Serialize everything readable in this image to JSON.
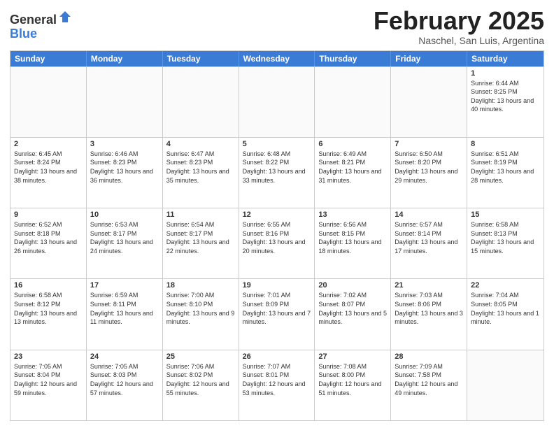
{
  "header": {
    "logo_general": "General",
    "logo_blue": "Blue",
    "month_title": "February 2025",
    "subtitle": "Naschel, San Luis, Argentina"
  },
  "days_of_week": [
    "Sunday",
    "Monday",
    "Tuesday",
    "Wednesday",
    "Thursday",
    "Friday",
    "Saturday"
  ],
  "weeks": [
    [
      {
        "day": "",
        "info": ""
      },
      {
        "day": "",
        "info": ""
      },
      {
        "day": "",
        "info": ""
      },
      {
        "day": "",
        "info": ""
      },
      {
        "day": "",
        "info": ""
      },
      {
        "day": "",
        "info": ""
      },
      {
        "day": "1",
        "info": "Sunrise: 6:44 AM\nSunset: 8:25 PM\nDaylight: 13 hours and 40 minutes."
      }
    ],
    [
      {
        "day": "2",
        "info": "Sunrise: 6:45 AM\nSunset: 8:24 PM\nDaylight: 13 hours and 38 minutes."
      },
      {
        "day": "3",
        "info": "Sunrise: 6:46 AM\nSunset: 8:23 PM\nDaylight: 13 hours and 36 minutes."
      },
      {
        "day": "4",
        "info": "Sunrise: 6:47 AM\nSunset: 8:23 PM\nDaylight: 13 hours and 35 minutes."
      },
      {
        "day": "5",
        "info": "Sunrise: 6:48 AM\nSunset: 8:22 PM\nDaylight: 13 hours and 33 minutes."
      },
      {
        "day": "6",
        "info": "Sunrise: 6:49 AM\nSunset: 8:21 PM\nDaylight: 13 hours and 31 minutes."
      },
      {
        "day": "7",
        "info": "Sunrise: 6:50 AM\nSunset: 8:20 PM\nDaylight: 13 hours and 29 minutes."
      },
      {
        "day": "8",
        "info": "Sunrise: 6:51 AM\nSunset: 8:19 PM\nDaylight: 13 hours and 28 minutes."
      }
    ],
    [
      {
        "day": "9",
        "info": "Sunrise: 6:52 AM\nSunset: 8:18 PM\nDaylight: 13 hours and 26 minutes."
      },
      {
        "day": "10",
        "info": "Sunrise: 6:53 AM\nSunset: 8:17 PM\nDaylight: 13 hours and 24 minutes."
      },
      {
        "day": "11",
        "info": "Sunrise: 6:54 AM\nSunset: 8:17 PM\nDaylight: 13 hours and 22 minutes."
      },
      {
        "day": "12",
        "info": "Sunrise: 6:55 AM\nSunset: 8:16 PM\nDaylight: 13 hours and 20 minutes."
      },
      {
        "day": "13",
        "info": "Sunrise: 6:56 AM\nSunset: 8:15 PM\nDaylight: 13 hours and 18 minutes."
      },
      {
        "day": "14",
        "info": "Sunrise: 6:57 AM\nSunset: 8:14 PM\nDaylight: 13 hours and 17 minutes."
      },
      {
        "day": "15",
        "info": "Sunrise: 6:58 AM\nSunset: 8:13 PM\nDaylight: 13 hours and 15 minutes."
      }
    ],
    [
      {
        "day": "16",
        "info": "Sunrise: 6:58 AM\nSunset: 8:12 PM\nDaylight: 13 hours and 13 minutes."
      },
      {
        "day": "17",
        "info": "Sunrise: 6:59 AM\nSunset: 8:11 PM\nDaylight: 13 hours and 11 minutes."
      },
      {
        "day": "18",
        "info": "Sunrise: 7:00 AM\nSunset: 8:10 PM\nDaylight: 13 hours and 9 minutes."
      },
      {
        "day": "19",
        "info": "Sunrise: 7:01 AM\nSunset: 8:09 PM\nDaylight: 13 hours and 7 minutes."
      },
      {
        "day": "20",
        "info": "Sunrise: 7:02 AM\nSunset: 8:07 PM\nDaylight: 13 hours and 5 minutes."
      },
      {
        "day": "21",
        "info": "Sunrise: 7:03 AM\nSunset: 8:06 PM\nDaylight: 13 hours and 3 minutes."
      },
      {
        "day": "22",
        "info": "Sunrise: 7:04 AM\nSunset: 8:05 PM\nDaylight: 13 hours and 1 minute."
      }
    ],
    [
      {
        "day": "23",
        "info": "Sunrise: 7:05 AM\nSunset: 8:04 PM\nDaylight: 12 hours and 59 minutes."
      },
      {
        "day": "24",
        "info": "Sunrise: 7:05 AM\nSunset: 8:03 PM\nDaylight: 12 hours and 57 minutes."
      },
      {
        "day": "25",
        "info": "Sunrise: 7:06 AM\nSunset: 8:02 PM\nDaylight: 12 hours and 55 minutes."
      },
      {
        "day": "26",
        "info": "Sunrise: 7:07 AM\nSunset: 8:01 PM\nDaylight: 12 hours and 53 minutes."
      },
      {
        "day": "27",
        "info": "Sunrise: 7:08 AM\nSunset: 8:00 PM\nDaylight: 12 hours and 51 minutes."
      },
      {
        "day": "28",
        "info": "Sunrise: 7:09 AM\nSunset: 7:58 PM\nDaylight: 12 hours and 49 minutes."
      },
      {
        "day": "",
        "info": ""
      }
    ]
  ]
}
